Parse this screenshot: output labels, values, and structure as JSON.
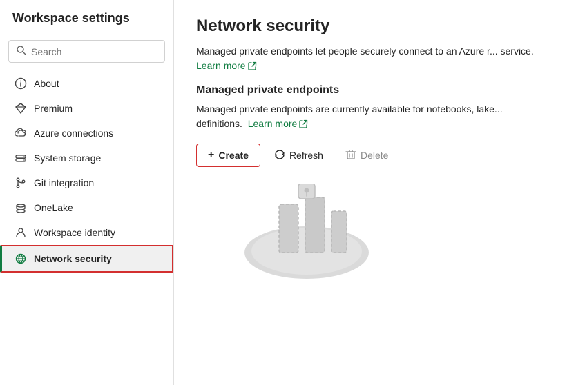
{
  "sidebar": {
    "title": "Workspace settings",
    "search": {
      "placeholder": "Search",
      "value": ""
    },
    "nav_items": [
      {
        "id": "about",
        "label": "About",
        "icon": "info-icon"
      },
      {
        "id": "premium",
        "label": "Premium",
        "icon": "diamond-icon"
      },
      {
        "id": "azure-connections",
        "label": "Azure connections",
        "icon": "cloud-icon"
      },
      {
        "id": "system-storage",
        "label": "System storage",
        "icon": "storage-icon"
      },
      {
        "id": "git-integration",
        "label": "Git integration",
        "icon": "git-icon"
      },
      {
        "id": "onelake",
        "label": "OneLake",
        "icon": "onelake-icon"
      },
      {
        "id": "workspace-identity",
        "label": "Workspace identity",
        "icon": "identity-icon"
      },
      {
        "id": "network-security",
        "label": "Network security",
        "icon": "network-icon",
        "active": true
      }
    ]
  },
  "main": {
    "page_title": "Network security",
    "description": "Managed private endpoints let people securely connect to an Azure r... service.",
    "learn_more_1": "Learn more",
    "section_title": "Managed private endpoints",
    "section_desc": "Managed private endpoints are currently available for notebooks, lake... definitions.",
    "learn_more_2": "Learn more",
    "toolbar": {
      "create_label": "Create",
      "refresh_label": "Refresh",
      "delete_label": "Delete"
    }
  }
}
